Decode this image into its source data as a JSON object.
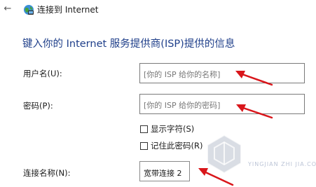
{
  "window": {
    "back_glyph": "←",
    "icon": "globe-network-icon",
    "title": "连接到 Internet"
  },
  "heading": "键入你的 Internet 服务提供商(ISP)提供的信息",
  "fields": {
    "username": {
      "label": "用户名(U):",
      "placeholder": "[你的 ISP 给你的名称]",
      "value": ""
    },
    "password": {
      "label": "密码(P):",
      "placeholder": "[你的 ISP 给你的密码]",
      "value": ""
    },
    "connection_name": {
      "label": "连接名称(N):",
      "value": "宽带连接 2"
    }
  },
  "checkboxes": {
    "show_chars": {
      "label": "显示字符(S)",
      "checked": false
    },
    "remember_password": {
      "label": "记住此密码(R)",
      "checked": false
    }
  },
  "annotation": {
    "arrow_color": "#d9161b"
  },
  "watermark": {
    "text": "硬件之家",
    "subtext": "YINGJIAN ZHI JIA.COM"
  },
  "colors": {
    "heading": "#1f3f8a",
    "border": "#7a7a7a"
  }
}
